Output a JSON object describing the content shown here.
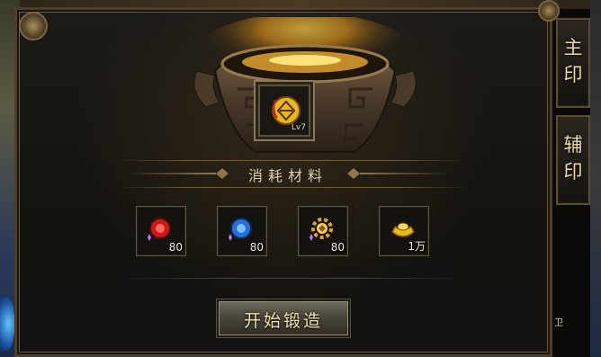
{
  "forge": {
    "section_title": "消耗材料",
    "item_level": "Lv7",
    "forge_button_label": "开始锻造"
  },
  "materials": [
    {
      "name": "red-gem-icon",
      "qty": "80",
      "color": "#d02020"
    },
    {
      "name": "blue-gem-icon",
      "qty": "80",
      "color": "#2a6fd6"
    },
    {
      "name": "gold-charm-icon",
      "qty": "80",
      "color": "#e0a020"
    },
    {
      "name": "gold-ingot-icon",
      "qty": "1万",
      "color": "#e8b820"
    }
  ],
  "tabs": [
    {
      "label_top": "主",
      "label_bottom": "印"
    },
    {
      "label_top": "辅",
      "label_bottom": "印"
    }
  ],
  "side_label": "卫",
  "colors": {
    "panel_border": "#4b3e2a",
    "accent_gold": "#d8cdb0"
  }
}
